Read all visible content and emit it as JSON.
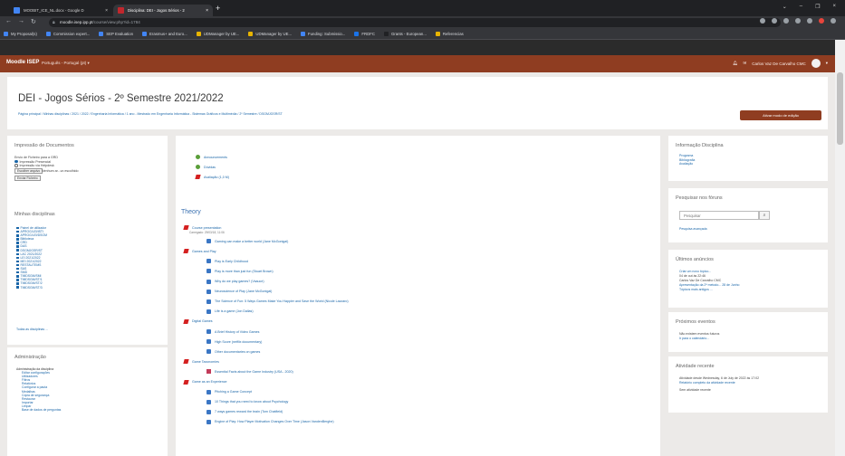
{
  "browser": {
    "tabs": [
      {
        "title": "MOOBIT_ICE_NL.docx - Google D",
        "color": "#4285f4"
      },
      {
        "title": "Disciplina: DEI - Jogos Sérios - 2",
        "color": "#c1272d"
      }
    ],
    "url_host": "moodle.isep.ipp.pt",
    "url_path": "/course/view.php?id=1784",
    "bookmarks": [
      {
        "label": "My Proposal(s)",
        "color": "#4285f4"
      },
      {
        "label": "Commission expert...",
        "color": "#4285f4"
      },
      {
        "label": "SEP Evaluation",
        "color": "#4285f4"
      },
      {
        "label": "Erasmus+ and Euro...",
        "color": "#4285f4"
      },
      {
        "label": "UDManager by UE...",
        "color": "#e8b400"
      },
      {
        "label": "UDManager by UE...",
        "color": "#e8b400"
      },
      {
        "label": "Funding: Submissio...",
        "color": "#4285f4"
      },
      {
        "label": "FRDFC",
        "color": "#1a73e8"
      },
      {
        "label": "Grants - European...",
        "color": "#202124"
      },
      {
        "label": "Referencias",
        "color": "#e8b400"
      }
    ]
  },
  "navbar": {
    "brand": "Moodle ISEP",
    "language": "Português - Portugal (pt) ▾",
    "user": "Carlos Vaz De Carvalho CMC"
  },
  "course": {
    "title": "DEI - Jogos Sérios - 2º Semestre 2021/2022",
    "breadcrumb": "Página principal / Minhas disciplinas / 2021 / 2022 / Engenharia Informática / 1 ano - Mestrado em Engenharia Informática - Sistemas Gráficos e Multimédia / 2º Semestre / DSGMJGSR/ST",
    "edit_button": "Ativar modo de edição"
  },
  "print_block": {
    "title": "Impressão de Documentos",
    "label": "Envio de Ficheiro para a GRD",
    "opt1": "Impressão Presencial",
    "opt2": "Impressão via Helpdesk",
    "choose": "Escolher arquivo",
    "nofile": "Nenhum ar...vo escolhido",
    "send": "Enviar Ficheiro"
  },
  "courses_block": {
    "title": "Minhas disciplinas",
    "items": [
      "Painel de utilizador",
      "APROG/LEI/ISTI",
      "APROG/LEI/DSGM",
      "Biblioteca",
      "CRD",
      "DAS",
      "DSGMJGSR/ST",
      "LAC 2021/2022",
      "LEI 2021/2022",
      "MEI 2021/2022",
      "RESTAUTEMS",
      "SAS",
      "SMD",
      "TMIDSGM/SMI",
      "TMIDSGM/ST/1",
      "TMIDSGM/ST/2",
      "TMIDSGM/ST/3"
    ],
    "all": "Todas as disciplinas ..."
  },
  "admin_block": {
    "title": "Administração",
    "items": [
      {
        "label": "Administração da disciplina",
        "level": 0
      },
      {
        "label": "Editar configurações",
        "level": 1
      },
      {
        "label": "Utilizadores",
        "level": 1
      },
      {
        "label": "Filtros",
        "level": 1
      },
      {
        "label": "Relatórios",
        "level": 1
      },
      {
        "label": "Configurar a pauta",
        "level": 1
      },
      {
        "label": "Medalhas",
        "level": 1
      },
      {
        "label": "Cópia de segurança",
        "level": 1
      },
      {
        "label": "Restaurar",
        "level": 1
      },
      {
        "label": "Importar",
        "level": 1
      },
      {
        "label": "Limpar",
        "level": 1
      },
      {
        "label": "Base de dados de perguntas",
        "level": 1
      }
    ]
  },
  "main": {
    "top_activities": [
      {
        "label": "Announcements",
        "icon": "forum"
      },
      {
        "label": "Dúvidas",
        "icon": "forum"
      },
      {
        "label": "Avaliação (1,0 M)",
        "icon": "pdf"
      }
    ],
    "section_title": "Theory",
    "activities": [
      {
        "label": "Course presentation",
        "icon": "pdf",
        "indent": 0,
        "desc": "Carregado: 29/03/18, 11:06"
      },
      {
        "label": "Gaming can make a better world (Jane McGonigal)",
        "icon": "url",
        "indent": 1
      },
      {
        "label": "Games and Play",
        "icon": "pdf",
        "indent": 0
      },
      {
        "label": "Play is Early Childhood",
        "icon": "url",
        "indent": 1
      },
      {
        "label": "Play is more than just fun (Stuart Brown)",
        "icon": "url",
        "indent": 1
      },
      {
        "label": "Why do we play games? (Vsauce)",
        "icon": "url",
        "indent": 1
      },
      {
        "label": "Neuroscience of Play (Jane McGonigal)",
        "icon": "url",
        "indent": 1
      },
      {
        "label": "The Science of Fun: 5 Ways Games Make You Happier and Save the World (Nicole Lazzaro)",
        "icon": "url",
        "indent": 1
      },
      {
        "label": "Life is a game (Jon Dallas)",
        "icon": "url",
        "indent": 1
      },
      {
        "label": "Digital Games",
        "icon": "pdf",
        "indent": 0
      },
      {
        "label": "A Brief History of Video Games",
        "icon": "url",
        "indent": 1
      },
      {
        "label": "High Score (netflix documentary)",
        "icon": "url",
        "indent": 1
      },
      {
        "label": "Other documentaries on games",
        "icon": "url",
        "indent": 1
      },
      {
        "label": "Game Taxonomies",
        "icon": "pdf",
        "indent": 0
      },
      {
        "label": "Essential Facts about the Game Industry (USA - 2020)",
        "icon": "quiz",
        "indent": 1
      },
      {
        "label": "Game as an Experience",
        "icon": "pdf",
        "indent": 0
      },
      {
        "label": "Pitching a Game Concept",
        "icon": "url",
        "indent": 1
      },
      {
        "label": "10 Things that you need to know about Psychology",
        "icon": "url",
        "indent": 1
      },
      {
        "label": "7 ways games reward the brain (Tom Chatfield)",
        "icon": "url",
        "indent": 1
      },
      {
        "label": "Engine of Play: How Player Motivation Changes Over Time (Jason VandenBerghe)",
        "icon": "url",
        "indent": 1
      }
    ]
  },
  "info_block": {
    "title": "Informação Disciplina",
    "items": [
      "Programa",
      "Bibliografia",
      "Avaliação"
    ]
  },
  "search_block": {
    "title": "Pesquisar nos fóruns",
    "placeholder": "Pesquisar",
    "advanced": "Pesquisa avançada"
  },
  "news_block": {
    "title": "Últimos anúncios",
    "lines": [
      "Criar um novo tópico...",
      "04 de out às 22:46",
      "Carlos Vaz De Carvalho CMC",
      "Apresentação da 2ª metodo... 28 de Junho",
      "Tópicos mais antigos ..."
    ]
  },
  "events_block": {
    "title": "Próximos eventos",
    "text": "Não existem eventos futuros",
    "link": "Ir para o calendário..."
  },
  "activity_block": {
    "title": "Atividade recente",
    "text": "Atividade desde Wednesday, 6 de July de 2022 às 17:02",
    "link": "Relatório completo da atividade recente",
    "empty": "Sem atividade recente"
  }
}
